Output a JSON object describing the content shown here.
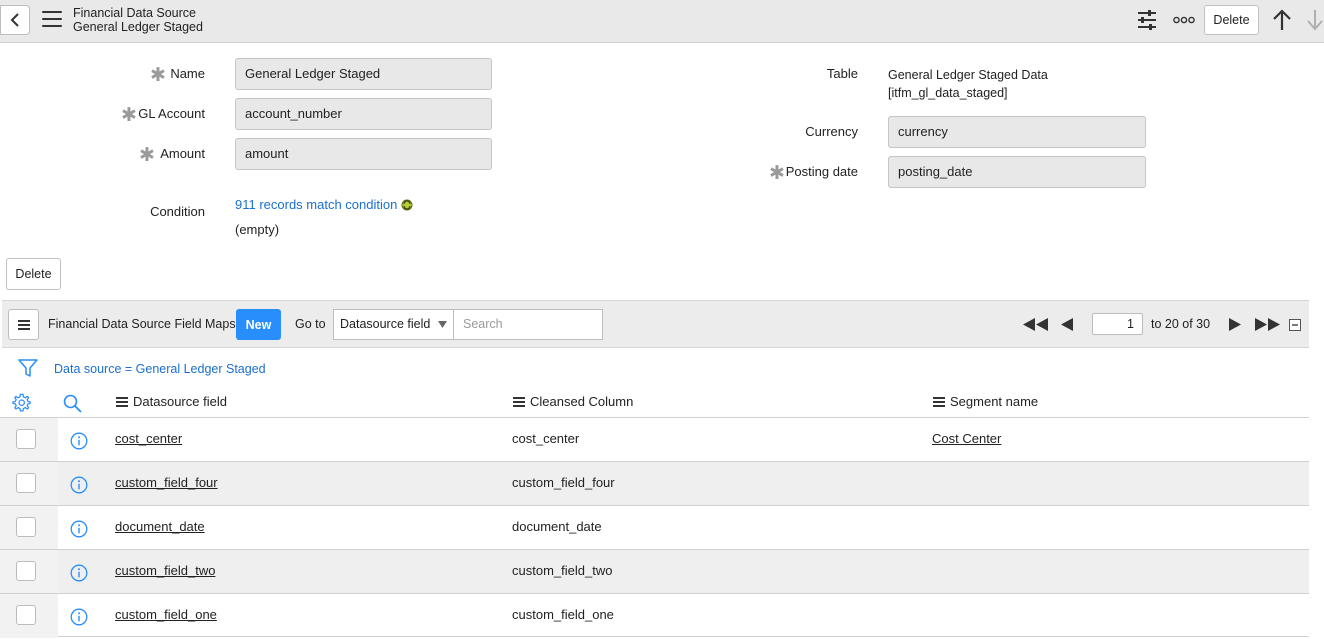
{
  "header": {
    "title_line1": "Financial Data Source",
    "title_line2": "General Ledger Staged",
    "delete_label": "Delete"
  },
  "form": {
    "name_label": "Name",
    "name_value": "General Ledger Staged",
    "gl_account_label": "GL Account",
    "gl_account_value": "account_number",
    "amount_label": "Amount",
    "amount_value": "amount",
    "condition_label": "Condition",
    "condition_link": "911 records match condition",
    "condition_value": "(empty)",
    "table_label": "Table",
    "table_value_line1": "General Ledger Staged Data",
    "table_value_line2": "[itfm_gl_data_staged]",
    "currency_label": "Currency",
    "currency_value": "currency",
    "posting_date_label": "Posting date",
    "posting_date_value": "posting_date",
    "delete_label": "Delete"
  },
  "list": {
    "title": "Financial Data Source Field Maps",
    "new_label": "New",
    "goto_label": "Go to",
    "goto_select": "Datasource field",
    "search_placeholder": "Search",
    "page_value": "1",
    "page_range": "to 20 of 30",
    "filter_text": "Data source = General Ledger Staged",
    "columns": [
      "Datasource field",
      "Cleansed Column",
      "Segment name"
    ],
    "rows": [
      {
        "datasource_field": "cost_center",
        "cleansed_column": "cost_center",
        "segment_name": "Cost Center"
      },
      {
        "datasource_field": "custom_field_four",
        "cleansed_column": "custom_field_four",
        "segment_name": ""
      },
      {
        "datasource_field": "document_date",
        "cleansed_column": "document_date",
        "segment_name": ""
      },
      {
        "datasource_field": "custom_field_two",
        "cleansed_column": "custom_field_two",
        "segment_name": ""
      },
      {
        "datasource_field": "custom_field_one",
        "cleansed_column": "custom_field_one",
        "segment_name": ""
      }
    ]
  }
}
